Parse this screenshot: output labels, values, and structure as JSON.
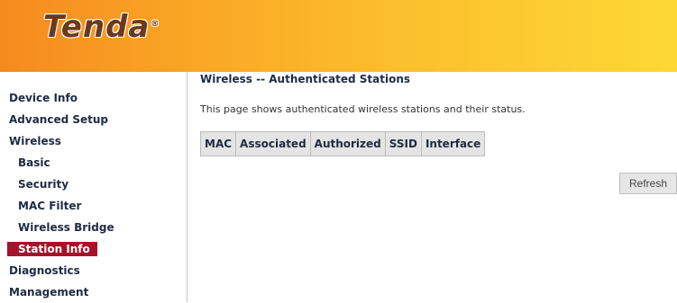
{
  "header": {
    "logo": "Tenda",
    "logo_mark": "®"
  },
  "sidebar": {
    "items": [
      {
        "label": "Device Info"
      },
      {
        "label": "Advanced Setup"
      },
      {
        "label": "Wireless"
      },
      {
        "label": "Basic"
      },
      {
        "label": "Security"
      },
      {
        "label": "MAC Filter"
      },
      {
        "label": "Wireless Bridge"
      },
      {
        "label": "Station Info"
      },
      {
        "label": "Diagnostics"
      },
      {
        "label": "Management"
      }
    ]
  },
  "main": {
    "title": "Wireless -- Authenticated Stations",
    "description": "This page shows authenticated wireless stations and their status.",
    "table": {
      "columns": [
        "MAC",
        "Associated",
        "Authorized",
        "SSID",
        "Interface"
      ]
    },
    "refresh_label": "Refresh"
  },
  "colors": {
    "active_bg": "#a5122a",
    "header_start": "#f58a1f",
    "header_end": "#fdd835"
  }
}
